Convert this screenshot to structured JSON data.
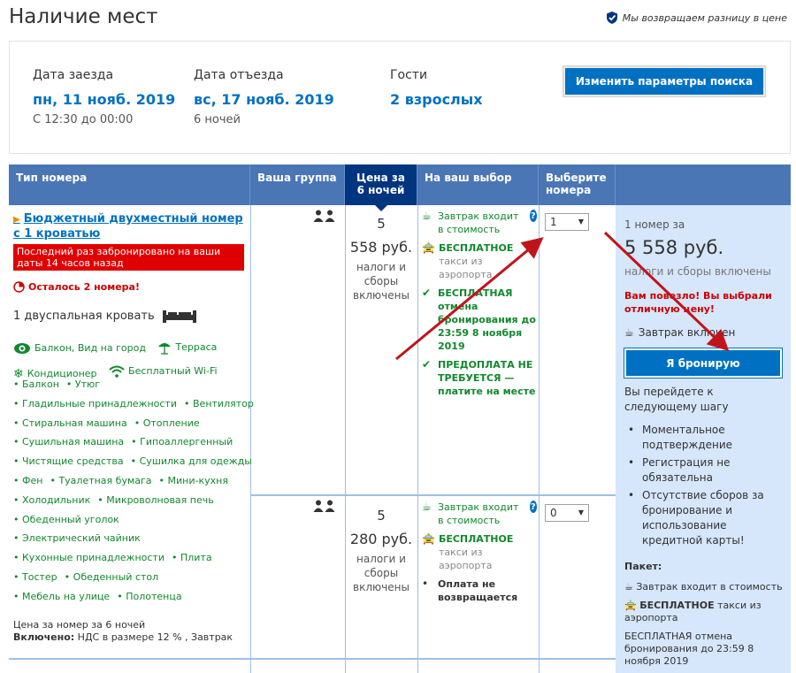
{
  "header": {
    "title": "Наличие мест",
    "refund_text": "Мы возвращаем разницу в цене"
  },
  "search": {
    "checkin_label": "Дата заезда",
    "checkin_value": "пн, 11 нояб. 2019",
    "checkin_sub": "С 12:30 до 00:00",
    "checkout_label": "Дата отъезда",
    "checkout_value": "вс, 17 нояб. 2019",
    "checkout_sub": "6 ночей",
    "guests_label": "Гости",
    "guests_value": "2 взрослых",
    "change_button": "Изменить параметры поиска"
  },
  "table_head": {
    "room_type": "Тип номера",
    "group": "Ваша группа",
    "price_line1": "Цена за",
    "price_line2": "6 ночей",
    "choice": "На ваш выбор",
    "select_line1": "Выберите",
    "select_line2": "номера"
  },
  "room": {
    "name": "Бюджетный двухместный номер с 1 кроватью",
    "last_booked": "Последний раз забронировано на ваши даты 14 часов назад",
    "left": "Осталось 2 номера!",
    "bed": "1 двуспальная кровать",
    "main_amenities": [
      "Балкон, Вид на город",
      "Терраса",
      "Кондиционер",
      "Бесплатный Wi-Fi"
    ],
    "amenities": [
      "Балкон",
      "Утюг",
      "Гладильные принадлежности",
      "Вентилятор",
      "Стиральная машина",
      "Отопление",
      "Сушильная машина",
      "Гипоаллергенный",
      "Чистящие средства",
      "Сушилка для одежды",
      "Фен",
      "Туалетная бумага",
      "Мини-кухня",
      "Холодильник",
      "Микроволновая печь",
      "Обеденный уголок",
      "Электрический чайник",
      "Кухонные принадлежности",
      "Плита",
      "Тостер",
      "Обеденный стол",
      "Мебель на улице",
      "Полотенца"
    ],
    "price_note": "Цена за номер за 6 ночей",
    "included_label": "Включено:",
    "included_value": "НДС в размере 12 % , Завтрак"
  },
  "options": [
    {
      "nights": "5",
      "price": "558 руб.",
      "tax": "налоги и сборы включены",
      "breakfast": "Завтрак входит в стоимость",
      "taxi_bold": "БЕСПЛАТНОЕ",
      "taxi_rest": "такси из аэропорта",
      "cancel": "БЕСПЛАТНАЯ отмена бронирования до 23:59 8 ноября 2019",
      "prepay": "ПРЕДОПЛАТА НЕ ТРЕБУЕТСЯ — платите на месте",
      "qty": "1"
    },
    {
      "nights": "5",
      "price": "280 руб.",
      "tax": "налоги и сборы включены",
      "breakfast": "Завтрак входит в стоимость",
      "taxi_bold": "БЕСПЛАТНОЕ",
      "taxi_rest": "такси из аэропорта",
      "nonrefund": "Оплата не возвращается",
      "qty": "0"
    }
  ],
  "summary": {
    "count": "1 номер за",
    "price": "5 558 руб.",
    "tax": "налоги и сборы включены",
    "lucky": "Вам повезло! Вы выбрали отличную цену!",
    "breakfast": "Завтрак включен",
    "book_button": "Я бронирую",
    "next_step": "Вы перейдете к следующему шагу",
    "benefits": [
      "Моментальное подтверждение",
      "Регистрация не обязательна",
      "Отсутствие сборов за бронирование и использование кредитной карты!"
    ],
    "package_label": "Пакет:",
    "package_breakfast": "Завтрак входит в стоимость",
    "package_taxi_bold": "БЕСПЛАТНОЕ",
    "package_taxi_rest": "такси из аэропорта",
    "package_cancel": "БЕСПЛАТНАЯ отмена бронирования до 23:59 8 ноября 2019"
  },
  "colors": {
    "brand_blue": "#0071c2",
    "header_blue": "#4b76b5",
    "dark_blue": "#003580",
    "green": "#11882d",
    "red": "#e10000",
    "arrow_red": "#c0141b"
  },
  "icons": [
    "check-shield-icon",
    "people-icon",
    "coffee-icon",
    "taxi-icon",
    "check-icon",
    "help-icon",
    "bed-icon",
    "eye-icon",
    "umbrella-icon",
    "snowflake-icon",
    "wifi-icon",
    "clock-icon"
  ]
}
